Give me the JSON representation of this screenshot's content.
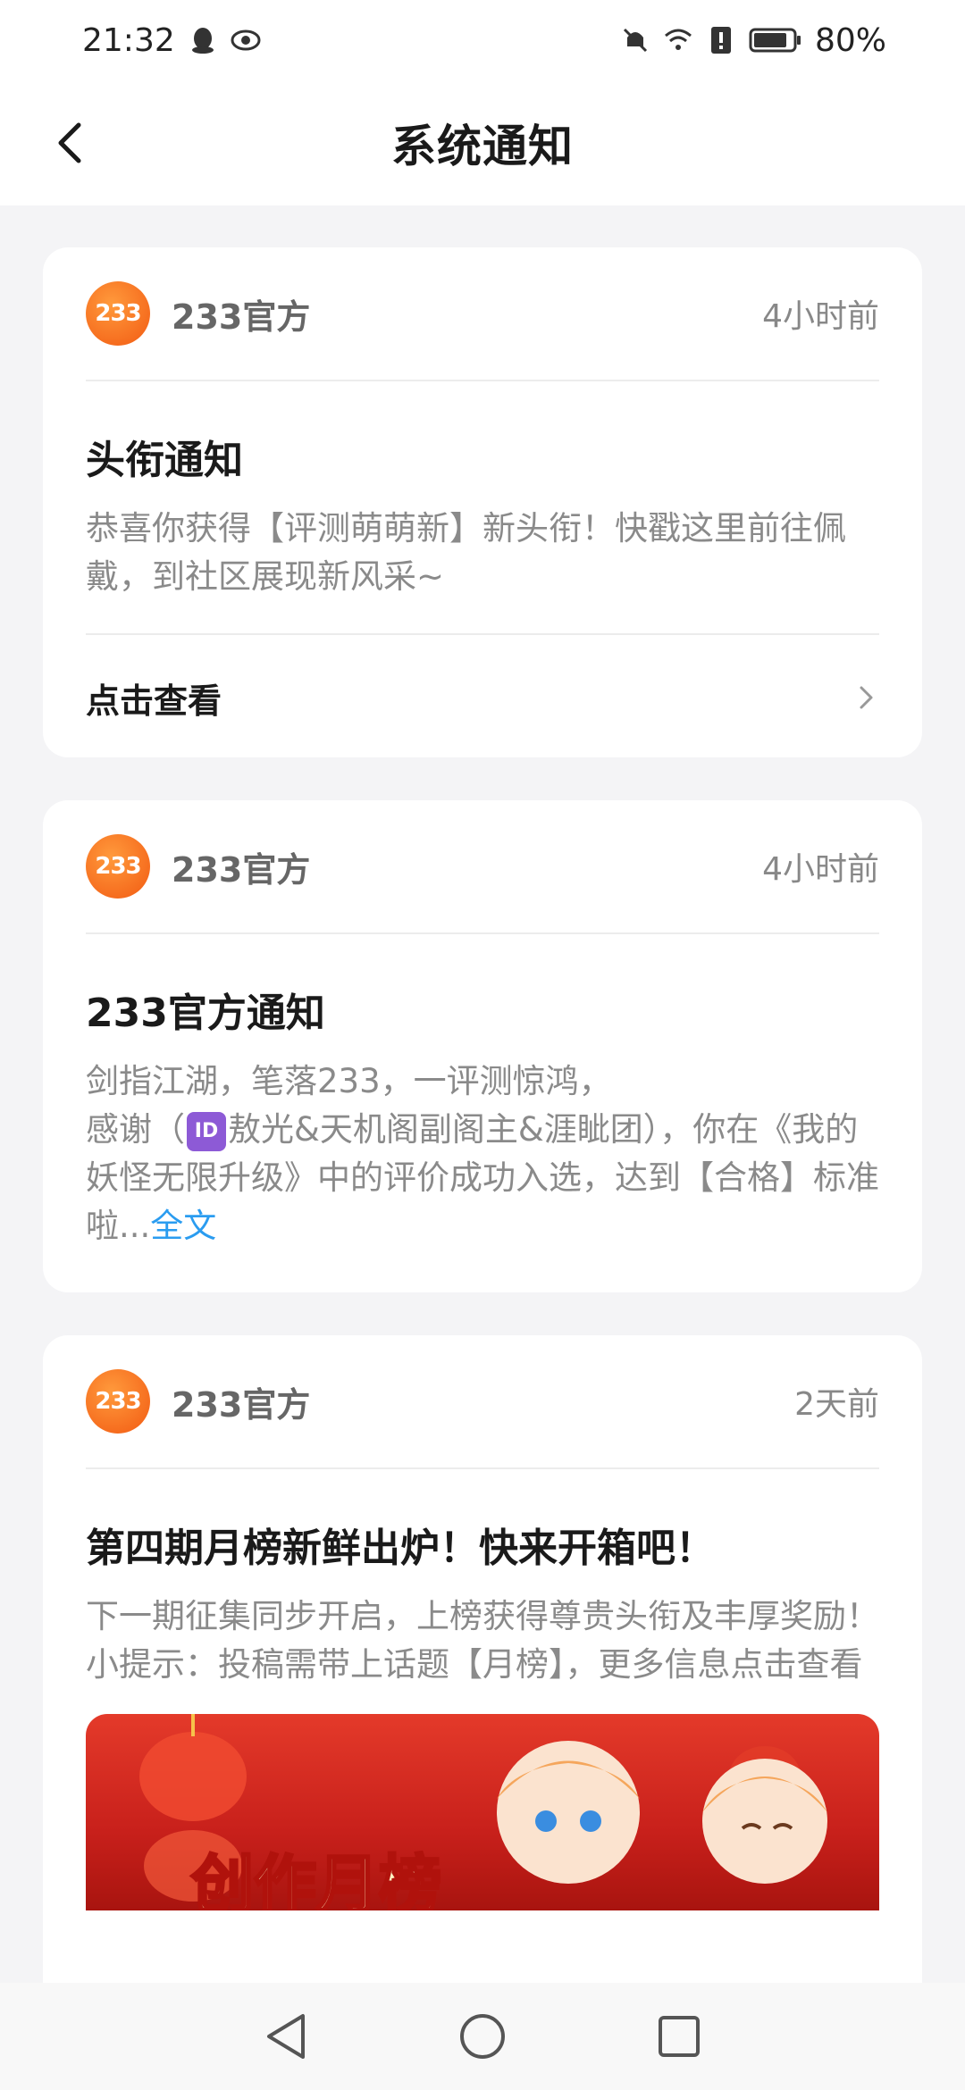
{
  "status_bar": {
    "time": "21:32",
    "battery": "80%",
    "left_icons": [
      "qq-penguin-icon",
      "eye-icon"
    ],
    "right_icons": [
      "mute-icon",
      "wifi-icon",
      "alert-icon",
      "battery-icon"
    ]
  },
  "header": {
    "title": "系统通知",
    "back_icon": "chevron-left-icon"
  },
  "cards": [
    {
      "avatar_text": "233",
      "sender": "233官方",
      "time": "4小时前",
      "title": "头衔通知",
      "body": "恭喜你获得【评测萌萌新】新头衔！快戳这里前往佩戴，到社区展现新风采~",
      "footer_label": "点击查看"
    },
    {
      "avatar_text": "233",
      "sender": "233官方",
      "time": "4小时前",
      "title": "233官方通知",
      "body_line1": "剑指江湖，笔落233，一评测惊鸿，",
      "body_pre_badge": "感谢（",
      "badge": "ID",
      "body_after_badge": "敖光&天机阁副阁主&涯眦团），你在《我的妖怪无限升级》中的评价成功入选，达到【合格】标准啦...",
      "fulltext_link": "全文"
    },
    {
      "avatar_text": "233",
      "sender": "233官方",
      "time": "2天前",
      "title": "第四期月榜新鲜出炉！快来开箱吧！",
      "body_line1": "下一期征集同步开启，上榜获得尊贵头衔及丰厚奖励！",
      "body_line2": "小提示：投稿需带上话题【月榜】，更多信息点击查看",
      "banner_text": "创作月榜"
    }
  ],
  "nav_bar": {
    "icons": [
      "back-triangle-icon",
      "home-circle-icon",
      "recents-square-icon"
    ]
  },
  "colors": {
    "accent_link": "#2a9cf0",
    "avatar_orange": "#f25a12",
    "background": "#f4f4f6"
  }
}
